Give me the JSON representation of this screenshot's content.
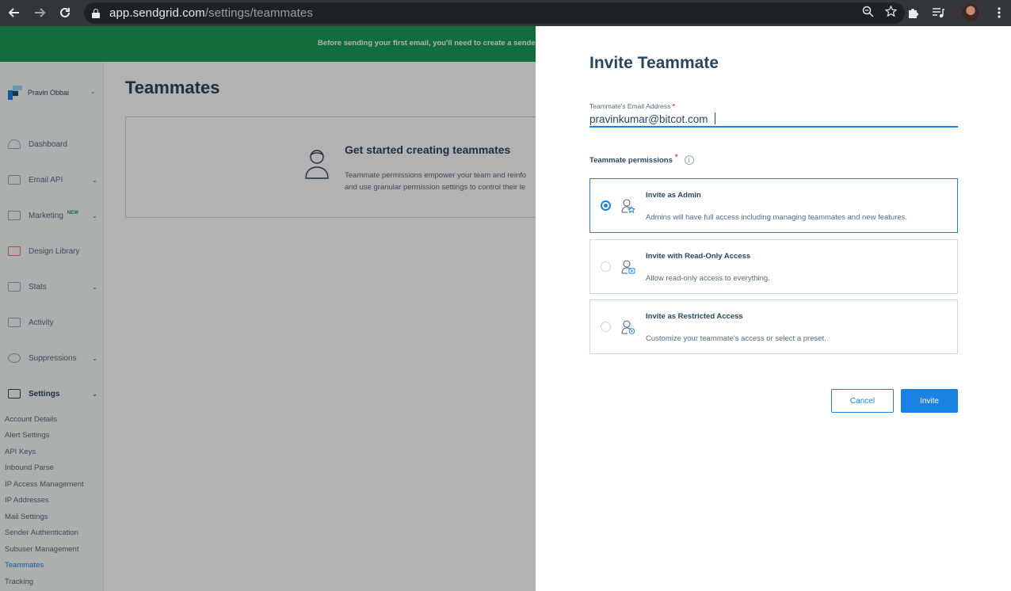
{
  "browser": {
    "url_host": "app.sendgrid.com",
    "url_path": "/settings/teammates"
  },
  "banner": {
    "text": "Before sending your first email, you'll need to create a sende"
  },
  "sidebar": {
    "account_name": "Pravin Obbai",
    "items": [
      {
        "label": "Dashboard"
      },
      {
        "label": "Email API"
      },
      {
        "label": "Marketing",
        "badge": "NEW"
      },
      {
        "label": "Design Library"
      },
      {
        "label": "Stats"
      },
      {
        "label": "Activity"
      },
      {
        "label": "Suppressions"
      },
      {
        "label": "Settings"
      }
    ],
    "settings_sub": [
      "Account Details",
      "Alert Settings",
      "API Keys",
      "Inbound Parse",
      "IP Access Management",
      "IP Addresses",
      "Mail Settings",
      "Sender Authentication",
      "Subuser Management",
      "Teammates",
      "Tracking"
    ]
  },
  "main": {
    "title": "Teammates",
    "card_title": "Get started creating teammates",
    "card_desc_line1": "Teammate permissions empower your team and reinfo",
    "card_desc_line2": "and use granular permission settings to control their le"
  },
  "panel": {
    "title": "Invite Teammate",
    "email_label": "Teammate's Email Address",
    "required_mark": "*",
    "email_value": "pravinkumar@bitcot.com",
    "permissions_label": "Teammate permissions",
    "info_glyph": "i",
    "options": [
      {
        "title": "Invite as Admin",
        "desc": "Admins will have full access including managing teammates and new features.",
        "selected": true
      },
      {
        "title": "Invite with Read-Only Access",
        "desc": "Allow read-only access to everything.",
        "selected": false
      },
      {
        "title": "Invite as Restricted Access",
        "desc": "Customize your teammate's access or select a preset.",
        "selected": false
      }
    ],
    "cancel_label": "Cancel",
    "invite_label": "Invite"
  },
  "colors": {
    "brand_green": "#1a9d56",
    "primary_blue": "#1a82e2",
    "navy": "#294661",
    "required_red": "#f22f46"
  },
  "icons": [
    "back-arrow-icon",
    "forward-arrow-icon",
    "reload-icon",
    "lock-icon",
    "zoom-icon",
    "star-icon",
    "puzzle-icon",
    "media-icon",
    "more-vert-icon"
  ]
}
